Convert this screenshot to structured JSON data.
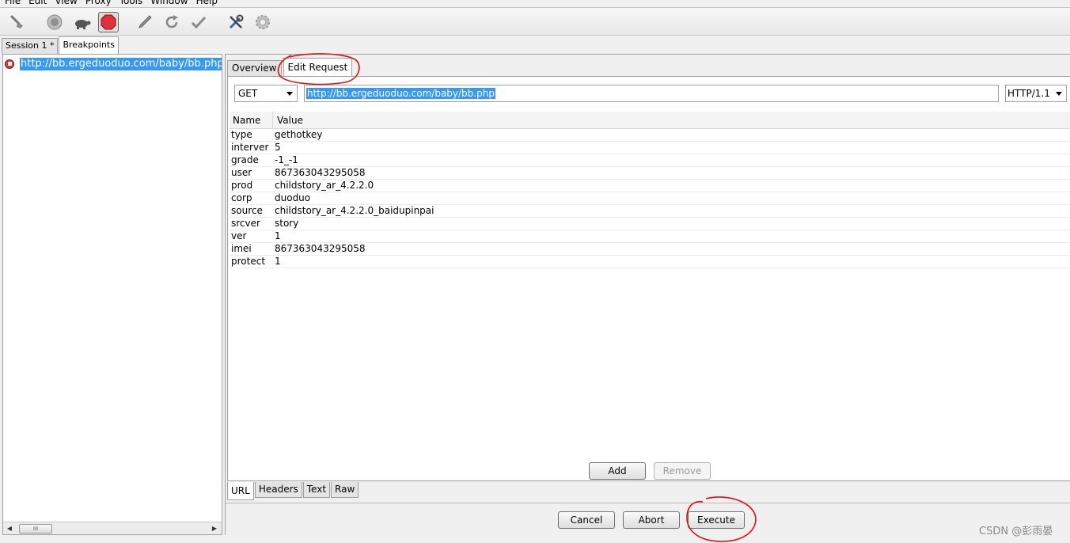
{
  "menu": [
    "File",
    "Edit",
    "View",
    "Proxy",
    "Tools",
    "Window",
    "Help"
  ],
  "toolbar": {
    "icons": [
      "broom-icon",
      "record-icon",
      "turtle-icon",
      "stop-breakpoint-icon",
      "pen-icon",
      "refresh-icon",
      "checkmark-icon",
      "tools-icon",
      "settings-gear-icon"
    ]
  },
  "session_tabs": [
    {
      "label": "Session 1 *"
    },
    {
      "label": "Breakpoints"
    }
  ],
  "breakpoint": {
    "url": "http://bb.ergeduoduo.com/baby/bb.php?ty"
  },
  "request_tabs": [
    {
      "label": "Overview"
    },
    {
      "label": "Edit Request"
    }
  ],
  "request": {
    "method": "GET",
    "url": "http://bb.ergeduoduo.com/baby/bb.php",
    "protocol": "HTTP/1.1"
  },
  "params": {
    "headers": {
      "name": "Name",
      "value": "Value"
    },
    "rows": [
      {
        "name": "type",
        "value": "gethotkey"
      },
      {
        "name": "interver",
        "value": "5"
      },
      {
        "name": "grade",
        "value": "-1_-1"
      },
      {
        "name": "user",
        "value": "867363043295058"
      },
      {
        "name": "prod",
        "value": "childstory_ar_4.2.2.0"
      },
      {
        "name": "corp",
        "value": "duoduo"
      },
      {
        "name": "source",
        "value": "childstory_ar_4.2.2.0_baidupinpai"
      },
      {
        "name": "srcver",
        "value": "story"
      },
      {
        "name": "ver",
        "value": "1"
      },
      {
        "name": "imei",
        "value": "867363043295058"
      },
      {
        "name": "protect",
        "value": "1"
      }
    ]
  },
  "buttons": {
    "add": "Add",
    "remove": "Remove",
    "cancel": "Cancel",
    "abort": "Abort",
    "execute": "Execute"
  },
  "view_tabs": [
    {
      "label": "URL"
    },
    {
      "label": "Headers"
    },
    {
      "label": "Text"
    },
    {
      "label": "Raw"
    }
  ],
  "watermark": "CSDN @彭雨晏",
  "colors": {
    "selection": "#3399ff",
    "annotation": "#e01010",
    "stop_button": "#d23b3b"
  }
}
